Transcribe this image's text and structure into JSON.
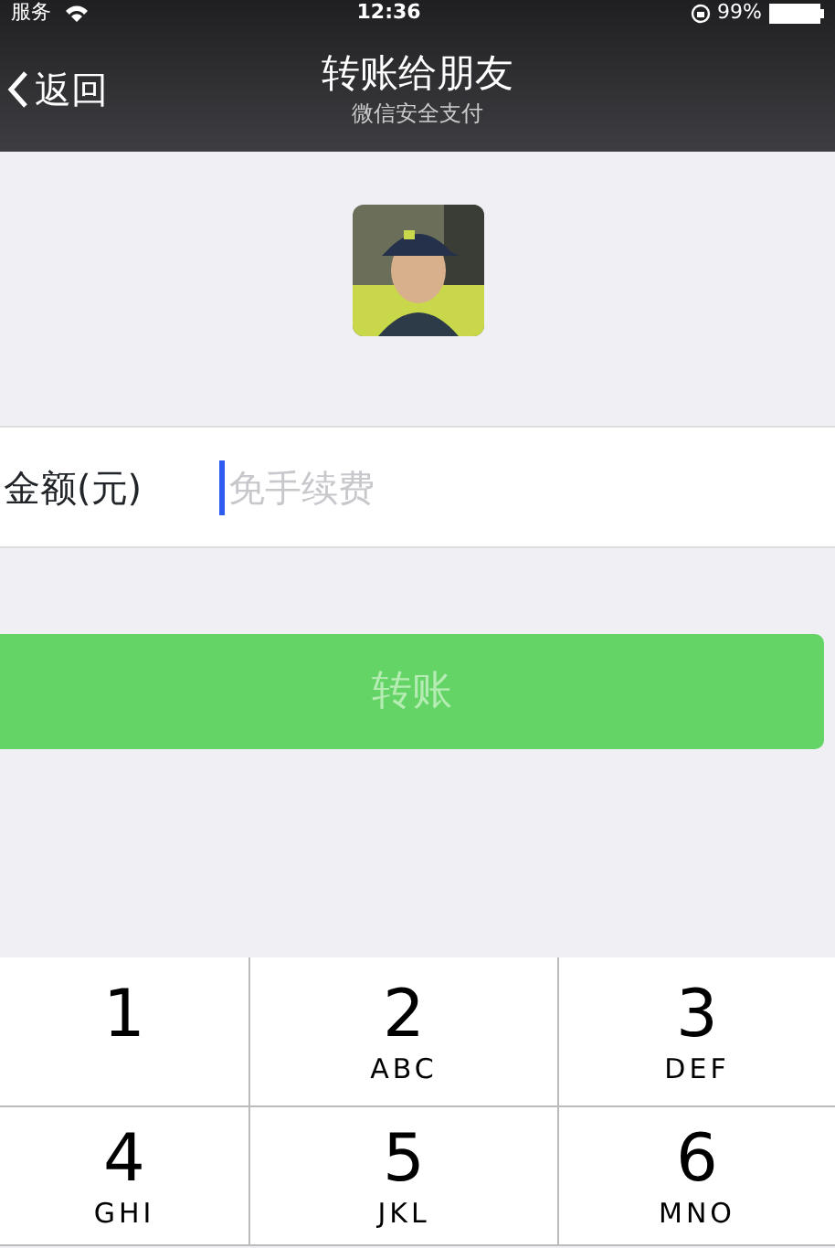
{
  "status_bar": {
    "carrier": "服务",
    "time": "12:36",
    "battery": "99%"
  },
  "nav": {
    "back": "返回",
    "title": "转账给朋友",
    "subtitle": "微信安全支付"
  },
  "amount": {
    "label": "金额(元)",
    "placeholder": "免手续费"
  },
  "transfer_button": {
    "label": "转账",
    "disabled": true
  },
  "keypad": [
    {
      "digit": "1"
    },
    {
      "digit": "2",
      "letters": "ABC"
    },
    {
      "digit": "3",
      "letters": "DEF"
    },
    {
      "digit": "4",
      "letters": "GHI"
    },
    {
      "digit": "5",
      "letters": "JKL"
    },
    {
      "digit": "6",
      "letters": "MNO"
    }
  ]
}
